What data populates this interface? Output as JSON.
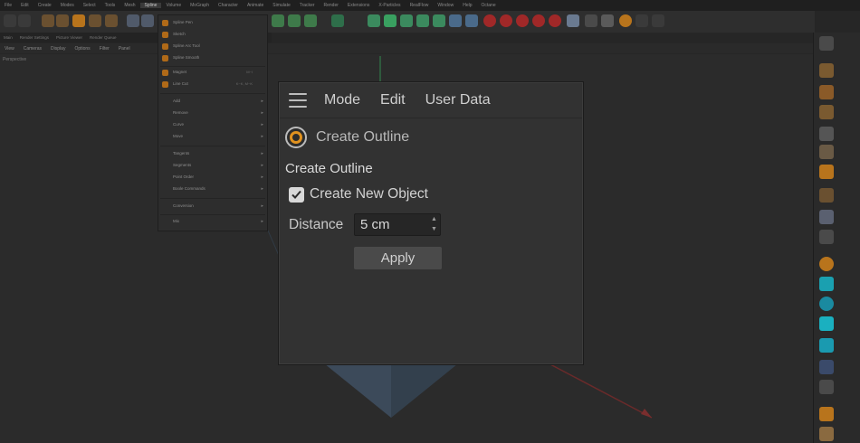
{
  "menubar": {
    "items": [
      "File",
      "Edit",
      "Create",
      "Modes",
      "Select",
      "Tools",
      "Mesh",
      "Spline",
      "Volume",
      "MoGraph",
      "Character",
      "Animate",
      "Simulate",
      "Tracker",
      "Render",
      "Extensions",
      "X-Particles",
      "RealFlow",
      "Window",
      "Help",
      "Octane"
    ]
  },
  "tabs": [
    "Main",
    "Render Settings",
    "Picture Viewer",
    "Render Queue"
  ],
  "viewmenu": [
    "View",
    "Cameras",
    "Display",
    "Options",
    "Filter",
    "Panel"
  ],
  "viewport": {
    "label": "Perspective"
  },
  "spline_menu": {
    "items": [
      {
        "label": "Spline Pen",
        "shortcut": ""
      },
      {
        "label": "Sketch",
        "shortcut": ""
      },
      {
        "label": "Spline Arc Tool",
        "shortcut": ""
      },
      {
        "label": "Spline Smooth",
        "shortcut": ""
      },
      {
        "label": "Magnet",
        "shortcut": "M~I"
      },
      {
        "label": "Line Cut",
        "shortcut": "K~K, M~K"
      }
    ],
    "sub_items": [
      "Add",
      "Remove",
      "Curve",
      "Move",
      "Tangents",
      "Segments",
      "Point Order",
      "Boole Commands",
      "Conversion",
      "Mix"
    ]
  },
  "dialog": {
    "menu": {
      "mode": "Mode",
      "edit": "Edit",
      "user_data": "User Data"
    },
    "command_title": "Create Outline",
    "section_title": "Create Outline",
    "create_new_object_label": "Create New Object",
    "create_new_object_checked": true,
    "distance_label": "Distance",
    "distance_value": "5 cm",
    "apply_label": "Apply"
  },
  "colors": {
    "accent": "#e0921f",
    "dialog_bg": "#323232",
    "background": "#262626"
  }
}
